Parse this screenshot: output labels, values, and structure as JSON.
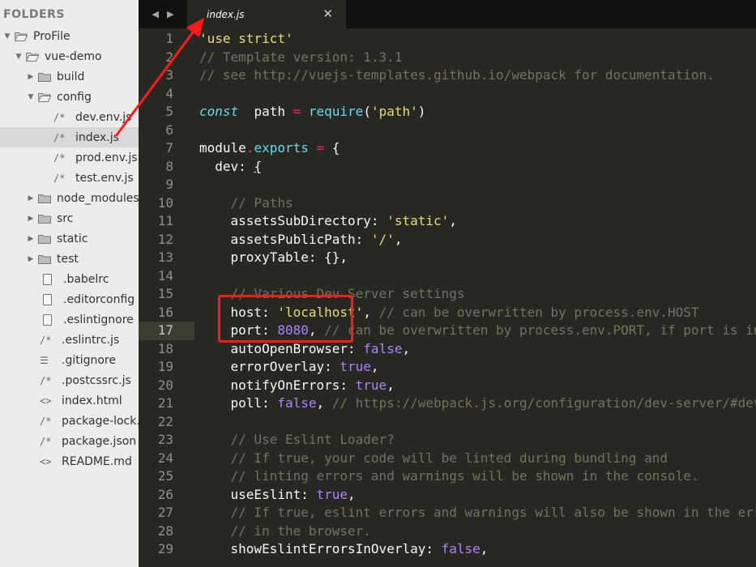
{
  "sidebar": {
    "title": "FOLDERS",
    "items": [
      {
        "label": "ProFile",
        "kind": "folder",
        "level": 0,
        "expanded": true
      },
      {
        "label": "vue-demo",
        "kind": "folder",
        "level": 1,
        "expanded": true
      },
      {
        "label": "build",
        "kind": "folder",
        "level": 2,
        "expanded": false
      },
      {
        "label": "config",
        "kind": "folder",
        "level": 2,
        "expanded": true
      },
      {
        "label": "dev.env.js",
        "kind": "file",
        "icon": "/*",
        "level": 3
      },
      {
        "label": "index.js",
        "kind": "file",
        "icon": "/*",
        "level": 3,
        "selected": true
      },
      {
        "label": "prod.env.js",
        "kind": "file",
        "icon": "/*",
        "level": 3
      },
      {
        "label": "test.env.js",
        "kind": "file",
        "icon": "/*",
        "level": 3
      },
      {
        "label": "node_modules",
        "kind": "folder",
        "level": 2,
        "expanded": false
      },
      {
        "label": "src",
        "kind": "folder",
        "level": 2,
        "expanded": false
      },
      {
        "label": "static",
        "kind": "folder",
        "level": 2,
        "expanded": false
      },
      {
        "label": "test",
        "kind": "folder",
        "level": 2,
        "expanded": false
      },
      {
        "label": ".babelrc",
        "kind": "file",
        "icon": "doc",
        "level": 2
      },
      {
        "label": ".editorconfig",
        "kind": "file",
        "icon": "doc",
        "level": 2
      },
      {
        "label": ".eslintignore",
        "kind": "file",
        "icon": "doc",
        "level": 2
      },
      {
        "label": ".eslintrc.js",
        "kind": "file",
        "icon": "/*",
        "level": 2
      },
      {
        "label": ".gitignore",
        "kind": "file",
        "icon": "☰",
        "level": 2
      },
      {
        "label": ".postcssrc.js",
        "kind": "file",
        "icon": "/*",
        "level": 2
      },
      {
        "label": "index.html",
        "kind": "file",
        "icon": "<>",
        "level": 2
      },
      {
        "label": "package-lock.json",
        "kind": "file",
        "icon": "/*",
        "level": 2
      },
      {
        "label": "package.json",
        "kind": "file",
        "icon": "/*",
        "level": 2
      },
      {
        "label": "README.md",
        "kind": "file",
        "icon": "<>",
        "level": 2
      }
    ]
  },
  "tabbar": {
    "back_icon": "◀",
    "forward_icon": "▶",
    "active_tab": "index.js",
    "close_icon": "✕"
  },
  "editor": {
    "current_line": 17,
    "lines": [
      {
        "n": "1",
        "t": [
          [
            "s",
            "'use strict'"
          ]
        ]
      },
      {
        "n": "2",
        "t": [
          [
            "c",
            "// Template version: 1.3.1"
          ]
        ]
      },
      {
        "n": "3",
        "t": [
          [
            "c",
            "// see http://vuejs-templates.github.io/webpack for documentation."
          ]
        ]
      },
      {
        "n": "4",
        "t": []
      },
      {
        "n": "5",
        "t": [
          [
            "k",
            "const"
          ],
          [
            "",
            "  path "
          ],
          [
            "p",
            "="
          ],
          [
            "",
            ""
          ],
          [
            "f",
            " require"
          ],
          [
            "",
            "("
          ],
          [
            "s",
            "'path'"
          ],
          [
            "",
            ")"
          ]
        ]
      },
      {
        "n": "6",
        "t": []
      },
      {
        "n": "7",
        "t": [
          [
            "",
            "module"
          ],
          [
            "p",
            "."
          ],
          [
            "f",
            "exports"
          ],
          [
            "p",
            " ="
          ],
          [
            "",
            " {"
          ]
        ]
      },
      {
        "n": "8",
        "t": [
          [
            "",
            "  dev: "
          ],
          [
            "u",
            "{"
          ]
        ]
      },
      {
        "n": "9",
        "t": []
      },
      {
        "n": "10",
        "t": [
          [
            "c",
            "    // Paths"
          ]
        ]
      },
      {
        "n": "11",
        "t": [
          [
            "",
            "    assetsSubDirectory: "
          ],
          [
            "s",
            "'static'"
          ],
          [
            "",
            ","
          ]
        ]
      },
      {
        "n": "12",
        "t": [
          [
            "",
            "    assetsPublicPath: "
          ],
          [
            "s",
            "'/'"
          ],
          [
            "",
            ","
          ]
        ]
      },
      {
        "n": "13",
        "t": [
          [
            "",
            "    proxyTable: {},"
          ]
        ]
      },
      {
        "n": "14",
        "t": []
      },
      {
        "n": "15",
        "t": [
          [
            "c",
            "    // Various Dev Server settings"
          ]
        ]
      },
      {
        "n": "16",
        "t": [
          [
            "",
            "    host: "
          ],
          [
            "s",
            "'localhost'"
          ],
          [
            "",
            ", "
          ],
          [
            "c",
            "// can be overwritten by process.env.HOST"
          ]
        ]
      },
      {
        "n": "17",
        "t": [
          [
            "",
            "    port: "
          ],
          [
            "n",
            "8080"
          ],
          [
            "",
            ", "
          ],
          [
            "c",
            "// can be overwritten by process.env.PORT, if port is in use, a free one will be determined"
          ]
        ]
      },
      {
        "n": "18",
        "t": [
          [
            "",
            "    autoOpenBrowser: "
          ],
          [
            "n",
            "false"
          ],
          [
            "",
            ","
          ]
        ]
      },
      {
        "n": "19",
        "t": [
          [
            "",
            "    errorOverlay: "
          ],
          [
            "n",
            "true"
          ],
          [
            "",
            ","
          ]
        ]
      },
      {
        "n": "20",
        "t": [
          [
            "",
            "    notifyOnErrors: "
          ],
          [
            "n",
            "true"
          ],
          [
            "",
            ","
          ]
        ]
      },
      {
        "n": "21",
        "t": [
          [
            "",
            "    poll: "
          ],
          [
            "n",
            "false"
          ],
          [
            "",
            ", "
          ],
          [
            "c",
            "// https://webpack.js.org/configuration/dev-server/#devserver-watchoptions-"
          ]
        ]
      },
      {
        "n": "22",
        "t": []
      },
      {
        "n": "23",
        "t": [
          [
            "c",
            "    // Use Eslint Loader?"
          ]
        ]
      },
      {
        "n": "24",
        "t": [
          [
            "c",
            "    // If true, your code will be linted during bundling and"
          ]
        ]
      },
      {
        "n": "25",
        "t": [
          [
            "c",
            "    // linting errors and warnings will be shown in the console."
          ]
        ]
      },
      {
        "n": "26",
        "t": [
          [
            "",
            "    useEslint: "
          ],
          [
            "n",
            "true"
          ],
          [
            "",
            ","
          ]
        ]
      },
      {
        "n": "27",
        "t": [
          [
            "c",
            "    // If true, eslint errors and warnings will also be shown in the error overlay"
          ]
        ]
      },
      {
        "n": "28",
        "t": [
          [
            "c",
            "    // in the browser."
          ]
        ]
      },
      {
        "n": "29",
        "t": [
          [
            "",
            "    showEslintErrorsInOverlay: "
          ],
          [
            "n",
            "false"
          ],
          [
            "",
            ","
          ]
        ]
      }
    ]
  },
  "colors": {
    "editor_bg": "#272822",
    "sidebar_bg": "#ececec",
    "annotation": "#ff1a1a"
  }
}
